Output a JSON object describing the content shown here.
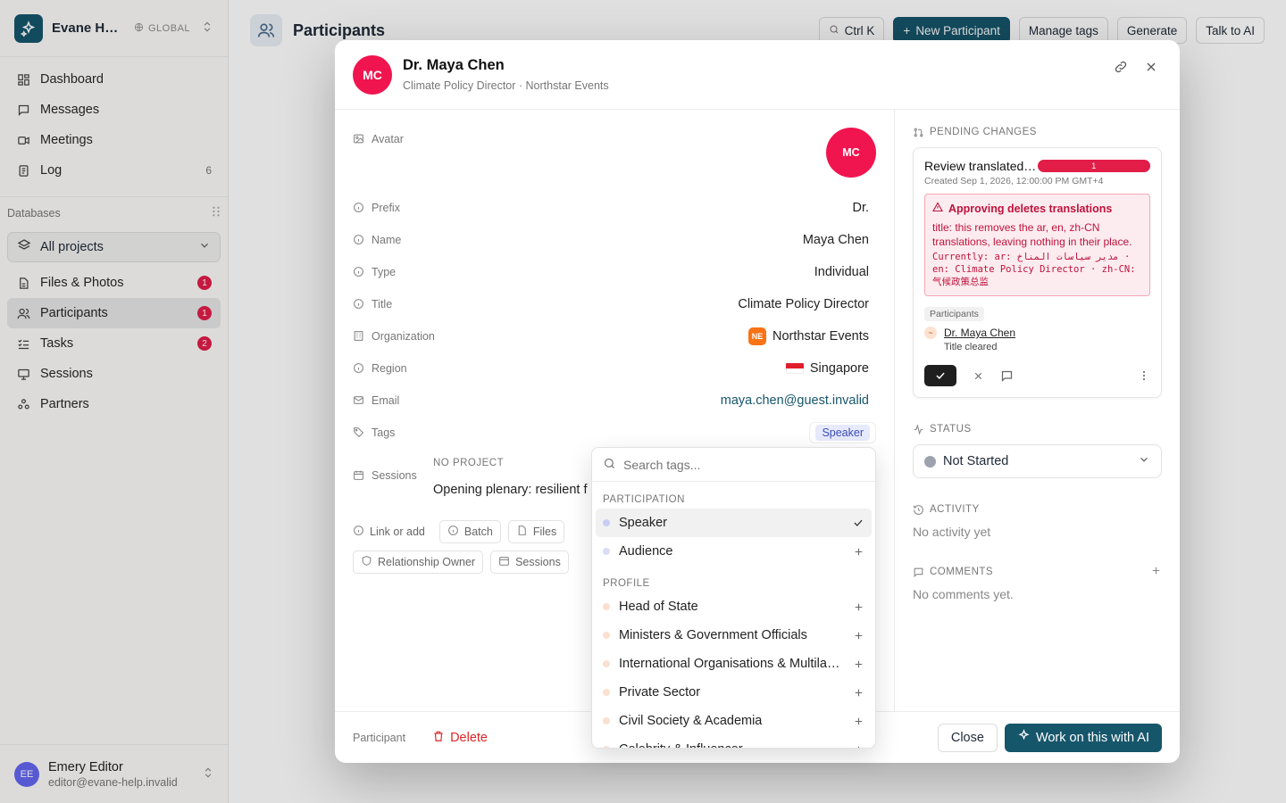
{
  "workspace": {
    "name": "Evane Help",
    "scope": "GLOBAL"
  },
  "nav": [
    {
      "label": "Dashboard",
      "icon": "grid-icon"
    },
    {
      "label": "Messages",
      "icon": "message-icon"
    },
    {
      "label": "Meetings",
      "icon": "video-icon"
    },
    {
      "label": "Log",
      "icon": "log-icon",
      "count": "6"
    }
  ],
  "databases": {
    "heading": "Databases",
    "project": "All projects",
    "items": [
      {
        "label": "Files & Photos",
        "badge": "1"
      },
      {
        "label": "Participants",
        "badge": "1"
      },
      {
        "label": "Tasks",
        "badge": "2"
      },
      {
        "label": "Sessions",
        "badge": ""
      },
      {
        "label": "Partners",
        "badge": ""
      }
    ]
  },
  "user": {
    "initials": "EE",
    "name": "Emery Editor",
    "email": "editor@evane-help.invalid"
  },
  "main": {
    "title": "Participants",
    "search_shortcut": "Ctrl K",
    "new_button": "New Participant",
    "manage_tags": "Manage tags",
    "generate": "Generate",
    "talk_ai": "Talk to AI"
  },
  "modal": {
    "initials": "MC",
    "name": "Dr. Maya Chen",
    "subtitle": "Climate Policy Director · Northstar Events",
    "fields": {
      "avatar_label": "Avatar",
      "prefix_label": "Prefix",
      "prefix": "Dr.",
      "name_label": "Name",
      "name": "Maya Chen",
      "type_label": "Type",
      "type": "Individual",
      "title_label": "Title",
      "title": "Climate Policy Director",
      "org_label": "Organization",
      "org_initials": "NE",
      "org": "Northstar Events",
      "region_label": "Region",
      "region": "Singapore",
      "email_label": "Email",
      "email": "maya.chen@guest.invalid",
      "tags_label": "Tags",
      "tag": "Speaker",
      "sessions_label": "Sessions",
      "session_project": "NO PROJECT",
      "session_item": "Opening plenary: resilient f"
    },
    "chips": [
      "Link or add",
      "Batch",
      "Files",
      "Relationship Owner",
      "Sessions"
    ],
    "footer": {
      "label": "Participant",
      "delete": "Delete",
      "close": "Close",
      "ai": "Work on this with AI"
    }
  },
  "pending": {
    "heading": "PENDING CHANGES",
    "card_title": "Review translated participant title",
    "badge": "1",
    "created": "Created Sep 1, 2026, 12:00:00 PM GMT+4",
    "warning_title": "Approving deletes translations",
    "warning_body": "title: this removes the ar, en, zh-CN translations, leaving nothing in their place.",
    "warning_current": "Currently: ar: مدير سياسات المناخ · en: Climate Policy Director · zh-CN: 气候政策总监",
    "entity_type": "Participants",
    "entity_name": "Dr. Maya Chen",
    "entity_note": "Title cleared"
  },
  "status": {
    "heading": "STATUS",
    "value": "Not Started"
  },
  "activity": {
    "heading": "ACTIVITY",
    "empty": "No activity yet"
  },
  "comments": {
    "heading": "COMMENTS",
    "empty": "No comments yet."
  },
  "tag_dropdown": {
    "placeholder": "Search tags...",
    "groups": [
      {
        "name": "PARTICIPATION",
        "items": [
          {
            "label": "Speaker",
            "selected": true,
            "color": "#c7cdf5"
          },
          {
            "label": "Audience",
            "selected": false,
            "color": "#d9dcf5"
          }
        ]
      },
      {
        "name": "PROFILE",
        "items": [
          {
            "label": "Head of State",
            "selected": false,
            "color": "#fbe0d0"
          },
          {
            "label": "Ministers & Government Officials",
            "selected": false,
            "color": "#fbe0d0"
          },
          {
            "label": "International Organisations & Multilateral",
            "selected": false,
            "color": "#fbe0d0"
          },
          {
            "label": "Private Sector",
            "selected": false,
            "color": "#fbe0d0"
          },
          {
            "label": "Civil Society & Academia",
            "selected": false,
            "color": "#fbe0d0"
          },
          {
            "label": "Celebrity & Influencer",
            "selected": false,
            "color": "#fbe0d0"
          }
        ]
      }
    ]
  },
  "colors": {
    "brand": "#16566b",
    "avatar": "#f0154f",
    "danger": "#dc2626"
  }
}
